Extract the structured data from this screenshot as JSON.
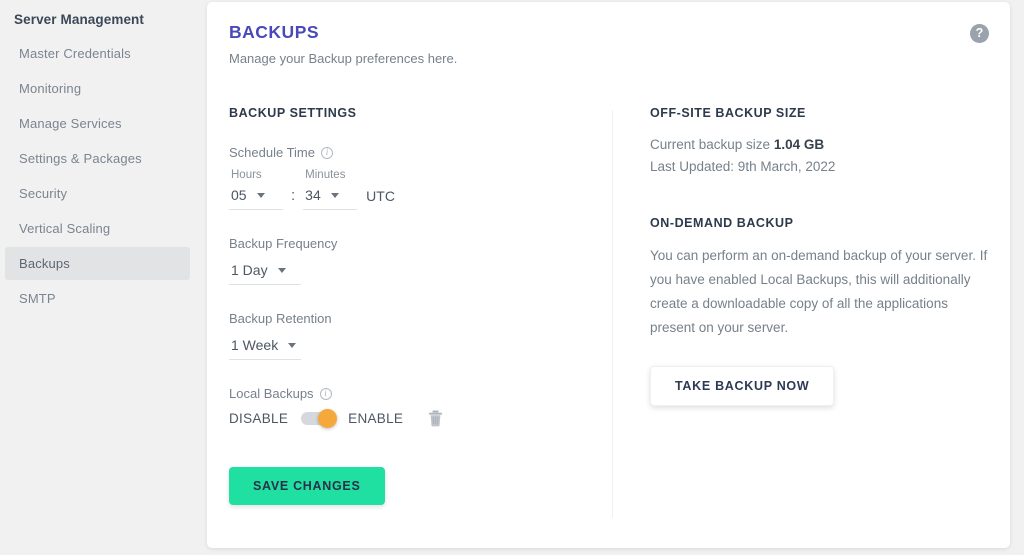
{
  "sidebar": {
    "title": "Server Management",
    "items": [
      {
        "label": "Master Credentials",
        "active": false
      },
      {
        "label": "Monitoring",
        "active": false
      },
      {
        "label": "Manage Services",
        "active": false
      },
      {
        "label": "Settings & Packages",
        "active": false
      },
      {
        "label": "Security",
        "active": false
      },
      {
        "label": "Vertical Scaling",
        "active": false
      },
      {
        "label": "Backups",
        "active": true
      },
      {
        "label": "SMTP",
        "active": false
      }
    ]
  },
  "header": {
    "title": "BACKUPS",
    "subtitle": "Manage your Backup preferences here.",
    "help_icon": "help-circle-icon",
    "help_glyph": "?",
    "title_color": "#4a49b8"
  },
  "backup_settings": {
    "section_title": "BACKUP SETTINGS",
    "schedule_time": {
      "label": "Schedule Time",
      "info_icon": "info-icon",
      "hours_caption": "Hours",
      "hours_value": "05",
      "separator": ":",
      "minutes_caption": "Minutes",
      "minutes_value": "34",
      "timezone": "UTC"
    },
    "backup_frequency": {
      "label": "Backup Frequency",
      "value": "1 Day"
    },
    "backup_retention": {
      "label": "Backup Retention",
      "value": "1 Week"
    },
    "local_backups": {
      "label": "Local Backups",
      "info_icon": "info-icon",
      "disable_label": "DISABLE",
      "enable_label": "ENABLE",
      "state": "ENABLE",
      "toggle_color": "#f4a93a",
      "delete_icon": "trash-icon"
    },
    "save_label": "SAVE CHANGES",
    "save_color": "#1fe0a0"
  },
  "offsite": {
    "section_title": "OFF-SITE BACKUP SIZE",
    "size_prefix": "Current backup size ",
    "size_value": "1.04 GB",
    "last_updated": "Last Updated: 9th March, 2022"
  },
  "ondemand": {
    "section_title": "ON-DEMAND BACKUP",
    "description": "You can perform an on-demand backup of your server. If you have enabled Local Backups, this will additionally create a downloadable copy of all the applications present on your server.",
    "button_label": "TAKE BACKUP NOW"
  }
}
